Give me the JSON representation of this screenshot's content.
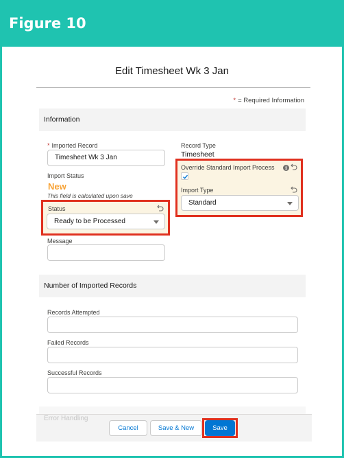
{
  "figure": {
    "title": "Figure 10"
  },
  "modal": {
    "title": "Edit Timesheet Wk 3 Jan"
  },
  "required_note": {
    "star": "*",
    "text": "= Required Information"
  },
  "sections": {
    "information": "Information",
    "imported_records": "Number of Imported Records",
    "error_handling": "Error Handling"
  },
  "fields": {
    "imported_record": {
      "label": "Imported Record",
      "required_star": "*",
      "value": "Timesheet Wk 3 Jan"
    },
    "import_status": {
      "label": "Import Status",
      "value": "New",
      "note": "This field is calculated upon save"
    },
    "status": {
      "label": "Status",
      "value": "Ready to be Processed"
    },
    "message": {
      "label": "Message",
      "value": ""
    },
    "record_type": {
      "label": "Record Type",
      "value": "Timesheet"
    },
    "override_standard": {
      "label": "Override Standard Import Process",
      "checked": true
    },
    "import_type": {
      "label": "Import Type",
      "value": "Standard"
    },
    "records_attempted": {
      "label": "Records Attempted",
      "value": ""
    },
    "failed_records": {
      "label": "Failed Records",
      "value": ""
    },
    "successful_records": {
      "label": "Successful Records",
      "value": ""
    }
  },
  "buttons": {
    "cancel": "Cancel",
    "save_new": "Save & New",
    "save": "Save"
  },
  "colors": {
    "teal": "#1fc3b0",
    "highlight": "#e0301e",
    "brand_blue": "#0176d3",
    "status_new": "#f7a235"
  }
}
